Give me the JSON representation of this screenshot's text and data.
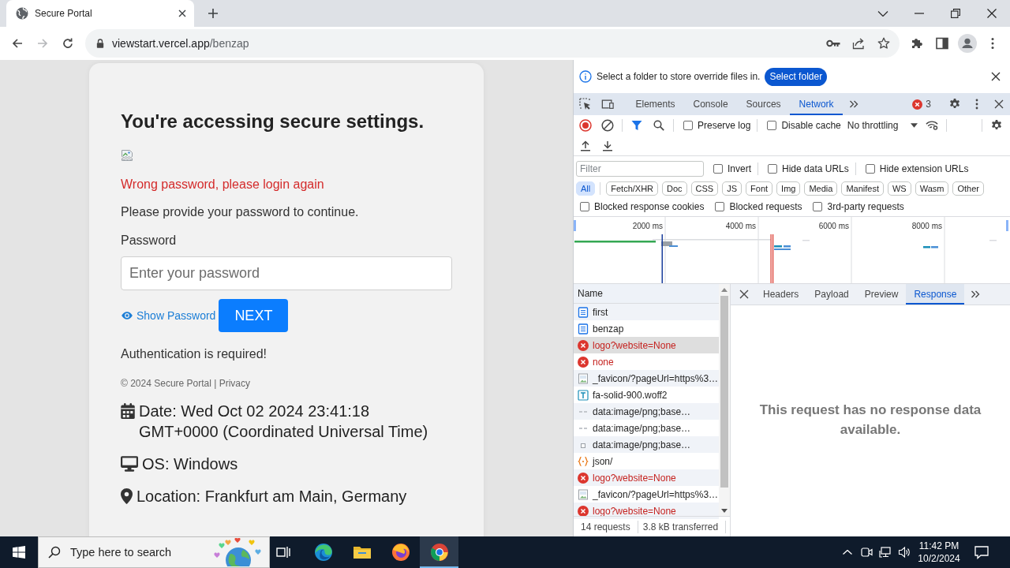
{
  "browser": {
    "tabs": [
      {
        "title": "Secure Portal",
        "selected": true
      }
    ],
    "nav_buttons": [
      {
        "kind": "back",
        "disabled": false
      },
      {
        "kind": "forward",
        "disabled": true
      },
      {
        "kind": "reload",
        "disabled": false
      }
    ],
    "address": {
      "host": "viewstart.vercel.app",
      "path": "/benzap"
    }
  },
  "page": {
    "heading": "You're accessing secure settings.",
    "error": "Wrong password, please login again",
    "prompt": "Please provide your password to continue.",
    "password_label": "Password",
    "password_placeholder": "Enter your password",
    "show_password": "Show Password",
    "next_button": "NEXT",
    "auth_note": "Authentication is required!",
    "footer": "© 2024 Secure Portal | Privacy",
    "info": [
      {
        "kind": "date",
        "text": "Date: Wed Oct 02 2024 23:41:18 GMT+0000 (Coordinated Universal Time)"
      },
      {
        "kind": "os",
        "text": "OS: Windows"
      },
      {
        "kind": "location",
        "text": "Location: Frankfurt am Main, Germany"
      }
    ]
  },
  "devtools": {
    "infobar": {
      "message": "Select a folder to store override files in.",
      "button": "Select folder"
    },
    "tabs": [
      {
        "label": "Elements",
        "selected": false
      },
      {
        "label": "Console",
        "selected": false
      },
      {
        "label": "Sources",
        "selected": false
      },
      {
        "label": "Network",
        "selected": true
      }
    ],
    "error_count": "3",
    "recording": true,
    "toolbar_options": [
      {
        "label": "Preserve log",
        "checked": false
      },
      {
        "label": "Disable cache",
        "checked": false
      }
    ],
    "throttling": "No throttling",
    "filter": {
      "placeholder": "Filter"
    },
    "filter_options": [
      {
        "label": "Invert",
        "checked": false
      },
      {
        "label": "Hide data URLs",
        "checked": false
      },
      {
        "label": "Hide extension URLs",
        "checked": false
      }
    ],
    "type_filters": [
      {
        "label": "All",
        "selected": true
      },
      {
        "label": "Fetch/XHR",
        "selected": false
      },
      {
        "label": "Doc",
        "selected": false
      },
      {
        "label": "CSS",
        "selected": false
      },
      {
        "label": "JS",
        "selected": false
      },
      {
        "label": "Font",
        "selected": false
      },
      {
        "label": "Img",
        "selected": false
      },
      {
        "label": "Media",
        "selected": false
      },
      {
        "label": "Manifest",
        "selected": false
      },
      {
        "label": "WS",
        "selected": false
      },
      {
        "label": "Wasm",
        "selected": false
      },
      {
        "label": "Other",
        "selected": false
      }
    ],
    "block_options": [
      {
        "label": "Blocked response cookies",
        "checked": false
      },
      {
        "label": "Blocked requests",
        "checked": false
      },
      {
        "label": "3rd-party requests",
        "checked": false
      }
    ],
    "overview": {
      "ticks": [
        "2000 ms",
        "4000 ms",
        "6000 ms",
        "8000 ms"
      ]
    },
    "requests": {
      "column": "Name",
      "rows": [
        {
          "name": "first",
          "kind": "document",
          "selected": false
        },
        {
          "name": "benzap",
          "kind": "document",
          "selected": false
        },
        {
          "name": "logo?website=None",
          "kind": "error",
          "selected": true
        },
        {
          "name": "none",
          "kind": "error",
          "selected": false
        },
        {
          "name": "_favicon/?pageUrl=https%3…",
          "kind": "image",
          "selected": false
        },
        {
          "name": "fa-solid-900.woff2",
          "kind": "font",
          "selected": false
        },
        {
          "name": "data:image/png;base…",
          "kind": "data",
          "selected": false
        },
        {
          "name": "data:image/png;base…",
          "kind": "data",
          "selected": false
        },
        {
          "name": "data:image/png;base…",
          "kind": "thumbnail",
          "selected": false
        },
        {
          "name": "json/",
          "kind": "json",
          "selected": false
        },
        {
          "name": "logo?website=None",
          "kind": "error",
          "selected": false
        },
        {
          "name": "_favicon/?pageUrl=https%3…",
          "kind": "image",
          "selected": false
        },
        {
          "name": "logo?website=None",
          "kind": "error",
          "selected": false
        }
      ]
    },
    "details": {
      "tabs": [
        {
          "label": "Headers",
          "selected": false
        },
        {
          "label": "Payload",
          "selected": false
        },
        {
          "label": "Preview",
          "selected": false
        },
        {
          "label": "Response",
          "selected": true
        }
      ],
      "message": "This request has no response data available."
    },
    "summary": {
      "requests": "14 requests",
      "transferred": "3.8 kB transferred"
    }
  },
  "taskbar": {
    "search": {
      "placeholder": "Type here to search"
    },
    "apps": [
      {
        "kind": "task-view",
        "active": false
      },
      {
        "kind": "edge",
        "active": false
      },
      {
        "kind": "files",
        "active": false
      },
      {
        "kind": "firefox",
        "active": false
      },
      {
        "kind": "chrome",
        "active": true
      }
    ],
    "clock": {
      "time": "11:42 PM",
      "date": "10/2/2024"
    }
  }
}
